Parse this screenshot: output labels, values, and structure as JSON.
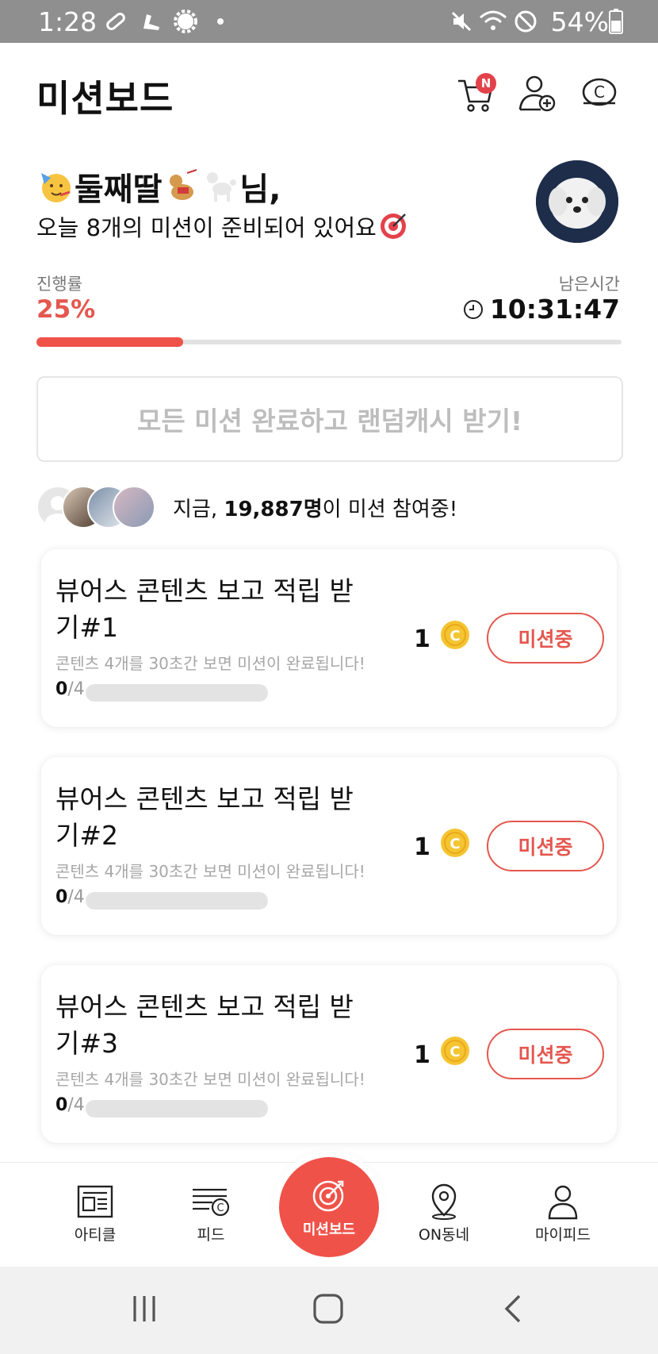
{
  "status_bar": {
    "time": "1:28",
    "battery": "54%"
  },
  "header": {
    "title": "미션보드",
    "cart_badge": "N"
  },
  "greeting": {
    "name": "둘째딸",
    "suffix": "님,",
    "message": "오늘 8개의 미션이 준비되어 있어요"
  },
  "progress": {
    "label": "진행률",
    "value": "25%",
    "fraction": 0.25
  },
  "timer": {
    "label": "남은시간",
    "value": "10:31:47"
  },
  "cta": {
    "label": "모든 미션 완료하고 랜덤캐시 받기!"
  },
  "participants": {
    "prefix": "지금, ",
    "count": "19,887명",
    "suffix": "이 미션 참여중!"
  },
  "missions": [
    {
      "title": "뷰어스 콘텐츠 보고 적립 받기#1",
      "desc": "콘텐츠 4개를 30초간 보면 미션이 완료됩니다!",
      "current": "0",
      "total": "/4",
      "reward": "1",
      "button": "미션중"
    },
    {
      "title": "뷰어스 콘텐츠 보고 적립 받기#2",
      "desc": "콘텐츠 4개를 30초간 보면 미션이 완료됩니다!",
      "current": "0",
      "total": "/4",
      "reward": "1",
      "button": "미션중"
    },
    {
      "title": "뷰어스 콘텐츠 보고 적립 받기#3",
      "desc": "콘텐츠 4개를 30초간 보면 미션이 완료됩니다!",
      "current": "0",
      "total": "/4",
      "reward": "1",
      "button": "미션중"
    }
  ],
  "bottom_nav": {
    "article": "아티클",
    "feed": "피드",
    "missionboard": "미션보드",
    "on_neighborhood": "ON동네",
    "my_feed": "마이피드"
  },
  "colors": {
    "accent": "#ef5249",
    "coin": "#f5c431",
    "status_bar": "#8f8f8f"
  }
}
